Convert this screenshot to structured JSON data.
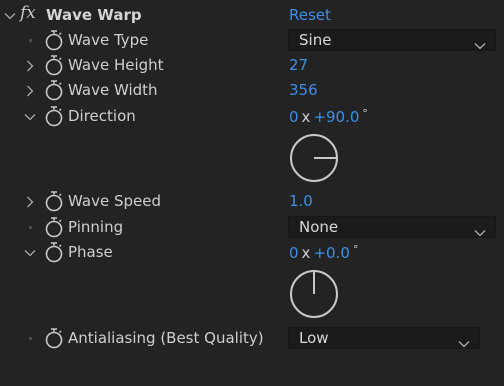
{
  "effect": {
    "fx_label": "fx",
    "title": "Wave Warp",
    "reset_label": "Reset"
  },
  "properties": {
    "wave_type": {
      "label": "Wave Type",
      "value": "Sine"
    },
    "wave_height": {
      "label": "Wave Height",
      "value": "27"
    },
    "wave_width": {
      "label": "Wave Width",
      "value": "356"
    },
    "direction": {
      "label": "Direction",
      "revolutions": "0",
      "x": "x",
      "angle": "+90.0",
      "degree": "°",
      "dial_degrees": 90
    },
    "wave_speed": {
      "label": "Wave Speed",
      "value": "1.0"
    },
    "pinning": {
      "label": "Pinning",
      "value": "None"
    },
    "phase": {
      "label": "Phase",
      "revolutions": "0",
      "x": "x",
      "angle": "+0.0",
      "degree": "°",
      "dial_degrees": 0
    },
    "antialiasing": {
      "label": "Antialiasing (Best Quality)",
      "value": "Low"
    }
  },
  "colors": {
    "background": "#232323",
    "value_blue": "#3d8fe8",
    "label": "#cfcfcf",
    "dropdown_bg": "#1b1b1b"
  },
  "icons": {
    "twirl_open": "chevron-down-icon",
    "twirl_closed": "chevron-right-icon",
    "stopwatch": "stopwatch-icon",
    "dropdown": "chevron-down-icon"
  }
}
